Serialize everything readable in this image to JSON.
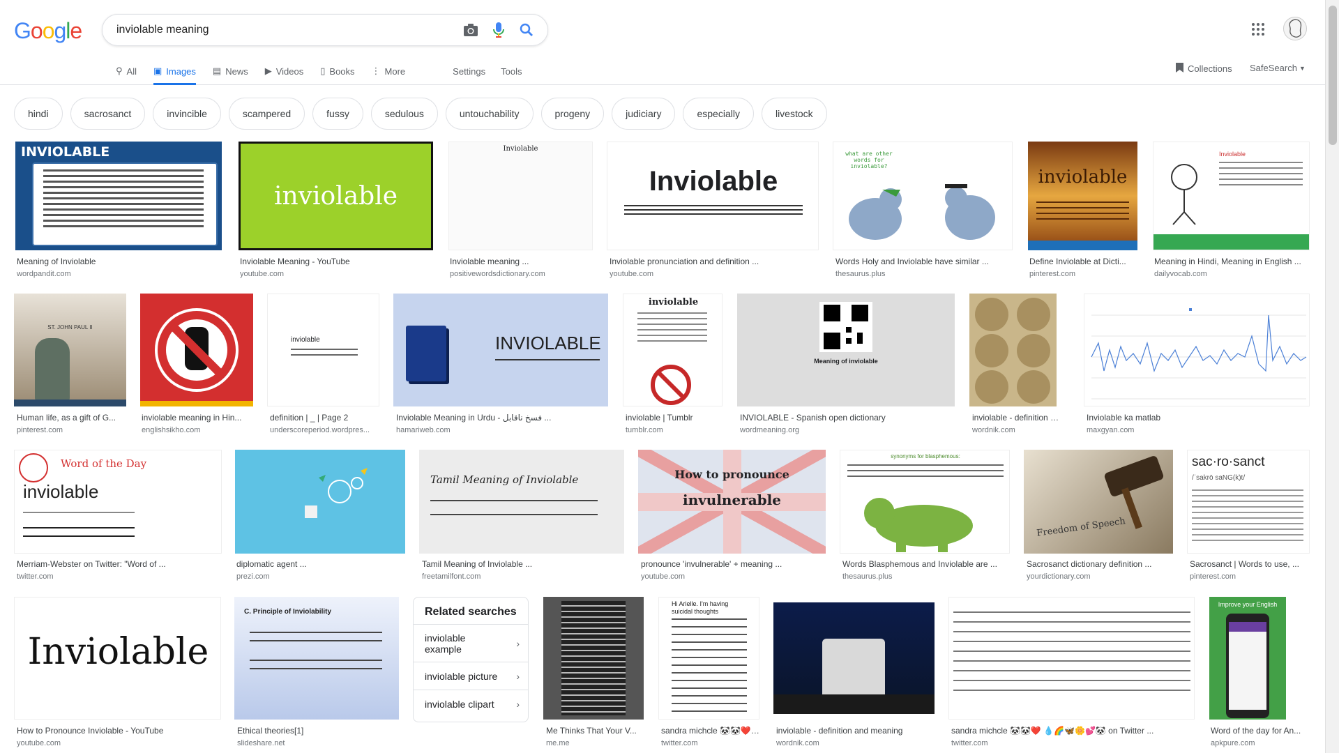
{
  "logo_letters": [
    "G",
    "o",
    "o",
    "g",
    "l",
    "e"
  ],
  "search": {
    "query": "inviolable meaning"
  },
  "tabs": [
    {
      "label": "All",
      "icon": "search-icon"
    },
    {
      "label": "Images",
      "icon": "image-icon"
    },
    {
      "label": "News",
      "icon": "news-icon"
    },
    {
      "label": "Videos",
      "icon": "video-icon"
    },
    {
      "label": "Books",
      "icon": "book-icon"
    },
    {
      "label": "More",
      "icon": "more-vert-icon"
    }
  ],
  "settings_label": "Settings",
  "tools_label": "Tools",
  "collections_label": "Collections",
  "safesearch_label": "SafeSearch",
  "chips": [
    "hindi",
    "sacrosanct",
    "invincible",
    "scampered",
    "fussy",
    "sedulous",
    "untouchability",
    "progeny",
    "judiciary",
    "especially",
    "livestock"
  ],
  "results": [
    {
      "caption": "Meaning of Inviolable",
      "source": "wordpandit.com",
      "thumb_text": "INVIOLABLE"
    },
    {
      "caption": "Inviolable Meaning - YouTube",
      "source": "youtube.com",
      "thumb_text": "inviolable"
    },
    {
      "caption": "Inviolable meaning ...",
      "source": "positivewordsdictionary.com",
      "thumb_text": "Inviolable"
    },
    {
      "caption": "Inviolable pronunciation and definition ...",
      "source": "youtube.com",
      "thumb_text": "Inviolable"
    },
    {
      "caption": "Words Holy and Inviolable have similar ...",
      "source": "thesaurus.plus",
      "thumb_text": "what are other words for inviolable?"
    },
    {
      "caption": "Define Inviolable at Dicti...",
      "source": "pinterest.com",
      "thumb_text": "inviolable"
    },
    {
      "caption": "Meaning in Hindi, Meaning in English ...",
      "source": "dailyvocab.com",
      "thumb_text": "Inviolable"
    },
    {
      "caption": "Human life, as a gift of G...",
      "source": "pinterest.com",
      "thumb_text": "ST. JOHN PAUL II"
    },
    {
      "caption": "inviolable meaning in Hin...",
      "source": "englishsikho.com",
      "thumb_text": ""
    },
    {
      "caption": "definition | _ | Page 2",
      "source": "underscoreperiod.wordpres...",
      "thumb_text": "inviolable"
    },
    {
      "caption": "Inviolable Meaning in Urdu - فسخ ناقابل ...",
      "source": "hamariweb.com",
      "thumb_text": "INVIOLABLE"
    },
    {
      "caption": "inviolable | Tumblr",
      "source": "tumblr.com",
      "thumb_text": "inviolable"
    },
    {
      "caption": "INVIOLABLE - Spanish open dictionary",
      "source": "wordmeaning.org",
      "thumb_text": "Meaning of inviolable"
    },
    {
      "caption": "inviolable - definition a...",
      "source": "wordnik.com",
      "thumb_text": ""
    },
    {
      "caption": "Inviolable ka matlab",
      "source": "maxgyan.com",
      "thumb_text": ""
    },
    {
      "caption": "Merriam-Webster on Twitter: \"Word of ...",
      "source": "twitter.com",
      "thumb_text": "inviolable"
    },
    {
      "caption": "diplomatic agent ...",
      "source": "prezi.com",
      "thumb_text": ""
    },
    {
      "caption": "Tamil Meaning of Inviolable ...",
      "source": "freetamilfont.com",
      "thumb_text": "Tamil Meaning of Inviolable"
    },
    {
      "caption": "pronounce 'invulnerable' + meaning ...",
      "source": "youtube.com",
      "thumb_text": "How to pronounce"
    },
    {
      "caption": "Words Blasphemous and Inviolable are ...",
      "source": "thesaurus.plus",
      "thumb_text": "synonyms for blasphemous:"
    },
    {
      "caption": "Sacrosanct dictionary definition ...",
      "source": "yourdictionary.com",
      "thumb_text": "Freedom of Speech"
    },
    {
      "caption": "Sacrosanct | Words to use, ...",
      "source": "pinterest.com",
      "thumb_text": "sac·ro·sanct"
    },
    {
      "caption": "How to Pronounce Inviolable - YouTube",
      "source": "youtube.com",
      "thumb_text": "Inviolable"
    },
    {
      "caption": "Ethical theories[1]",
      "source": "slideshare.net",
      "thumb_text": "C. Principle of Inviolability"
    },
    {
      "caption": "Me Thinks That Your V...",
      "source": "me.me",
      "thumb_text": ""
    },
    {
      "caption": "sandra michcle 🐼🐼❤️ ...",
      "source": "twitter.com",
      "thumb_text": "Hi Arielle. I'm having suicidal thoughts"
    },
    {
      "caption": "inviolable - definition and meaning",
      "source": "wordnik.com",
      "thumb_text": ""
    },
    {
      "caption": "sandra michcle 🐼🐼❤️ 💧🌈🦋🌼💕🐼 on Twitter ...",
      "source": "twitter.com",
      "thumb_text": ""
    },
    {
      "caption": "Word of the day for An...",
      "source": "apkpure.com",
      "thumb_text": "Improve your English"
    }
  ],
  "related": {
    "title": "Related searches",
    "items": [
      "inviolable example",
      "inviolable picture",
      "inviolable clipart"
    ]
  },
  "colors": {
    "accent": "#1a73e8",
    "border": "#dfe1e5"
  }
}
